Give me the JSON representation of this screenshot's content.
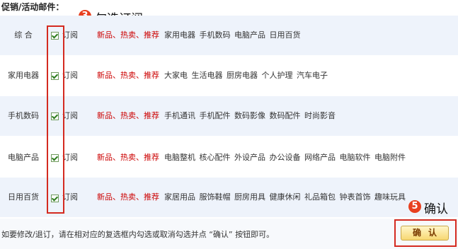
{
  "section_title": "促销/活动邮件：",
  "annotations": {
    "step3_number": "3",
    "step3_text": "勾选订阅",
    "step5_number": "5",
    "step5_text": "确认"
  },
  "rows": [
    {
      "name": "综  合",
      "checked": true,
      "subscribe_label": "订阅",
      "tags": "新品、热卖、推荐",
      "categories": "家用电器 手机数码 电脑产品 日用百货"
    },
    {
      "name": "家用电器",
      "checked": true,
      "subscribe_label": "订阅",
      "tags": "新品、热卖、推荐",
      "categories": "大家电 生活电器 厨房电器 个人护理 汽车电子"
    },
    {
      "name": "手机数码",
      "checked": true,
      "subscribe_label": "订阅",
      "tags": "新品、热卖、推荐",
      "categories": "手机通讯 手机配件 数码影像 数码配件 时尚影音"
    },
    {
      "name": "电脑产品",
      "checked": true,
      "subscribe_label": "订阅",
      "tags": "新品、热卖、推荐",
      "categories": "电脑整机 核心配件 外设产品 办公设备 网络产品 电脑软件 电脑附件"
    },
    {
      "name": "日用百货",
      "checked": true,
      "subscribe_label": "订阅",
      "tags": "新品、热卖、推荐",
      "categories": "家居用品 服饰鞋帽 厨房用具 健康休闲 礼品箱包 钟表首饰 趣味玩具"
    }
  ],
  "footer_text": "如要修改/退订，请在相对应的复选框内勾选或取消勾选并点 “确认” 按钮即可。",
  "confirm_label": "确认",
  "colors": {
    "tag_red": "#cc0000",
    "annotation_red": "#d42a20",
    "row_alt": "#eef3fb"
  }
}
